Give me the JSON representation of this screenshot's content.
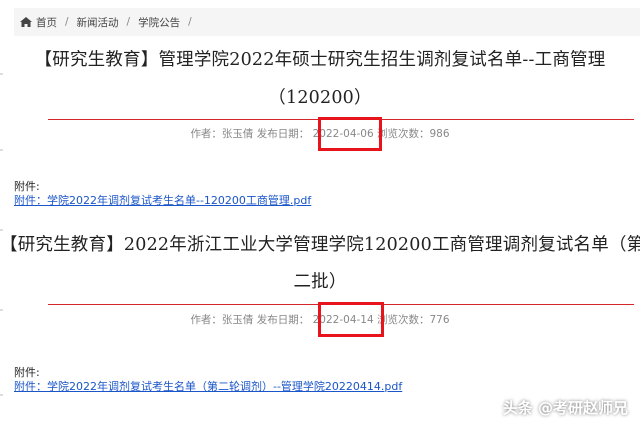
{
  "breadcrumb": {
    "home": "首页",
    "items": [
      "新闻活动",
      "学院公告"
    ],
    "separator": "/"
  },
  "articles": [
    {
      "title_line1": "【研究生教育】管理学院2022年硕士研究生招生调剂复试名单--工商管理",
      "title_line2": "（120200）",
      "author": "作者：张玉倩",
      "date_label": "发布日期：",
      "date": "2022-04-06",
      "views_label": "浏览次数：",
      "views": "986",
      "attach_label": "附件:",
      "attach_link": "附件：学院2022年调剂复试考生名单--120200工商管理.pdf"
    },
    {
      "title_line1": "【研究生教育】2022年浙江工业大学管理学院120200工商管理调剂复试名单（第",
      "title_line2": "二批）",
      "author": "作者：张玉倩",
      "date_label": "发布日期：",
      "date": "2022-04-14",
      "views_label": "浏览次数：",
      "views": "776",
      "attach_label": "附件:",
      "attach_link": "附件：学院2022年调剂复试考生名单（第二轮调剂）--管理学院20220414.pdf"
    }
  ],
  "watermark": "头条 @考研赵师兄",
  "colors": {
    "accent_line": "#d7262b",
    "highlight": "#e8141b",
    "link": "#1a55c9"
  }
}
